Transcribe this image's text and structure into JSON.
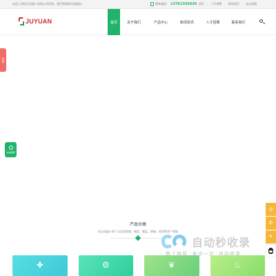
{
  "topbar": {
    "welcome": "欢迎上海钜元机器人有限公司官网，我们将竭诚为您服务！",
    "phone_label": "联系电话：",
    "phone_number": "13761342636",
    "links": [
      "首页",
      "人才招聘",
      "联系我们",
      "站点地图"
    ]
  },
  "header": {
    "logo_text": "JUYUAN",
    "nav": [
      "首页",
      "关于我们",
      "产品中心",
      "新闻资讯",
      "人才招聘",
      "联系我们"
    ],
    "active_index": 0
  },
  "left_tab": {
    "label": "分享"
  },
  "online_service": {
    "label": "在线客服"
  },
  "right_bar": {
    "icons": [
      "wechat-icon",
      "phone-icon",
      "message-icon",
      "qq-icon"
    ]
  },
  "products": {
    "title": "产品分类",
    "subtitle": "钜元机器人的广泛应用领域：制造、搬运、焊接、喷涂等多个领域",
    "cards": [
      {
        "icon": "cross-icon"
      },
      {
        "icon": "robot-arm-icon"
      },
      {
        "icon": "leaf-icon"
      },
      {
        "icon": "flame-icon"
      }
    ]
  },
  "watermark": {
    "text": "自动秒收录",
    "slogan": "数上链接 ·来访一次 ·自动收录"
  },
  "colors": {
    "primary_green": "#21b36b",
    "logo_red": "#d42b2b",
    "share_red": "#f26a6a",
    "float_orange": "#f5b63a"
  }
}
